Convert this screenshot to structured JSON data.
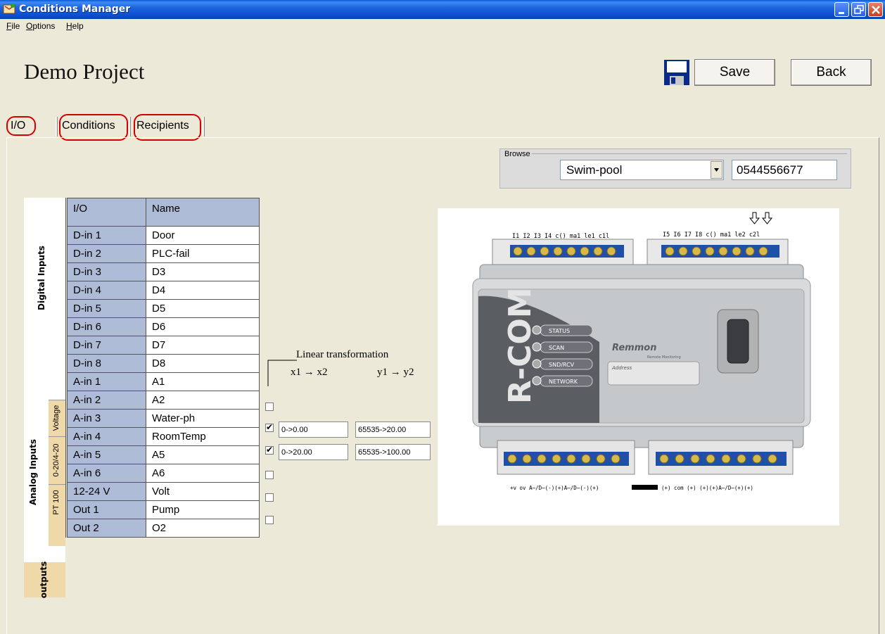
{
  "window": {
    "title": "Conditions Manager"
  },
  "menu": {
    "items": [
      {
        "label": "File",
        "u": "F",
        "rest": "ile"
      },
      {
        "label": "Options",
        "u": "O",
        "rest": "ptions"
      },
      {
        "label": "Help",
        "u": "H",
        "rest": "elp"
      }
    ]
  },
  "project": {
    "title": "Demo Project"
  },
  "toolbar": {
    "save_label": "Save",
    "back_label": "Back"
  },
  "tabs": [
    {
      "label": "I/O",
      "selected": true
    },
    {
      "label": "Conditions",
      "selected": false
    },
    {
      "label": "Recipients",
      "selected": false
    }
  ],
  "browse": {
    "legend": "Browse",
    "selected_option": "Swim-pool",
    "phone_value": "0544556677"
  },
  "io_table": {
    "headers": {
      "io": "I/O",
      "name": "Name"
    },
    "rows": [
      {
        "io": "D-in 1",
        "name": "Door"
      },
      {
        "io": "D-in 2",
        "name": "PLC-fail"
      },
      {
        "io": "D-in 3",
        "name": "D3"
      },
      {
        "io": "D-in 4",
        "name": "D4"
      },
      {
        "io": "D-in 5",
        "name": "D5"
      },
      {
        "io": "D-in 6",
        "name": "D6"
      },
      {
        "io": "D-in 7",
        "name": "D7"
      },
      {
        "io": "D-in 8",
        "name": "D8"
      },
      {
        "io": "A-in 1",
        "name": "A1"
      },
      {
        "io": "A-in 2",
        "name": "A2"
      },
      {
        "io": "A-in 3",
        "name": "Water-ph"
      },
      {
        "io": "A-in 4",
        "name": "RoomTemp"
      },
      {
        "io": "A-in 5",
        "name": "A5"
      },
      {
        "io": "A-in 6",
        "name": "A6"
      },
      {
        "io": "12-24 V",
        "name": "Volt"
      },
      {
        "io": "Out 1",
        "name": "Pump"
      },
      {
        "io": "Out 2",
        "name": "O2"
      }
    ]
  },
  "groups": {
    "digital": "Digital Inputs",
    "analog": "Analog Inputs",
    "outputs": "outputs",
    "voltage": "Voltage",
    "current": "0-20/4-20",
    "pt100": "PT 100"
  },
  "linear": {
    "title": "Linear transformation",
    "x_label": "x1 → x2",
    "y_label": "y1 → y2",
    "rows": [
      {
        "checked": false,
        "x": "",
        "y": ""
      },
      {
        "checked": true,
        "x": "0->0.00",
        "y": "65535->20.00"
      },
      {
        "checked": true,
        "x": "0->20.00",
        "y": "65535->100.00"
      },
      {
        "checked": false,
        "x": "",
        "y": ""
      },
      {
        "checked": false,
        "x": "",
        "y": ""
      },
      {
        "checked": false,
        "x": "",
        "y": ""
      }
    ]
  },
  "device": {
    "brand": "R-COM",
    "maker": "Remmon",
    "maker_sub": "Remote Monitoring",
    "address_label": "Address",
    "leds": [
      "STATUS",
      "SCAN",
      "SND/RCV",
      "NETWORK"
    ],
    "top_left_labels": "I1 I2 I3 I4 c() ma1 le1 c1l",
    "top_right_labels": "I5 I6 I7 I8 c() ma1 le2 c2l",
    "bottom_left_labels": "+v ov A̶/D̶(-)(+)A̶/D̶(-)(+)",
    "bottom_right_labels": "(+) com (+)  (+)(+)A̶/D̶(+)(+)"
  },
  "colors": {
    "selected_cell": "#aebbd6",
    "group_tan": "#f0d9a8",
    "highlight": "#d40000"
  }
}
